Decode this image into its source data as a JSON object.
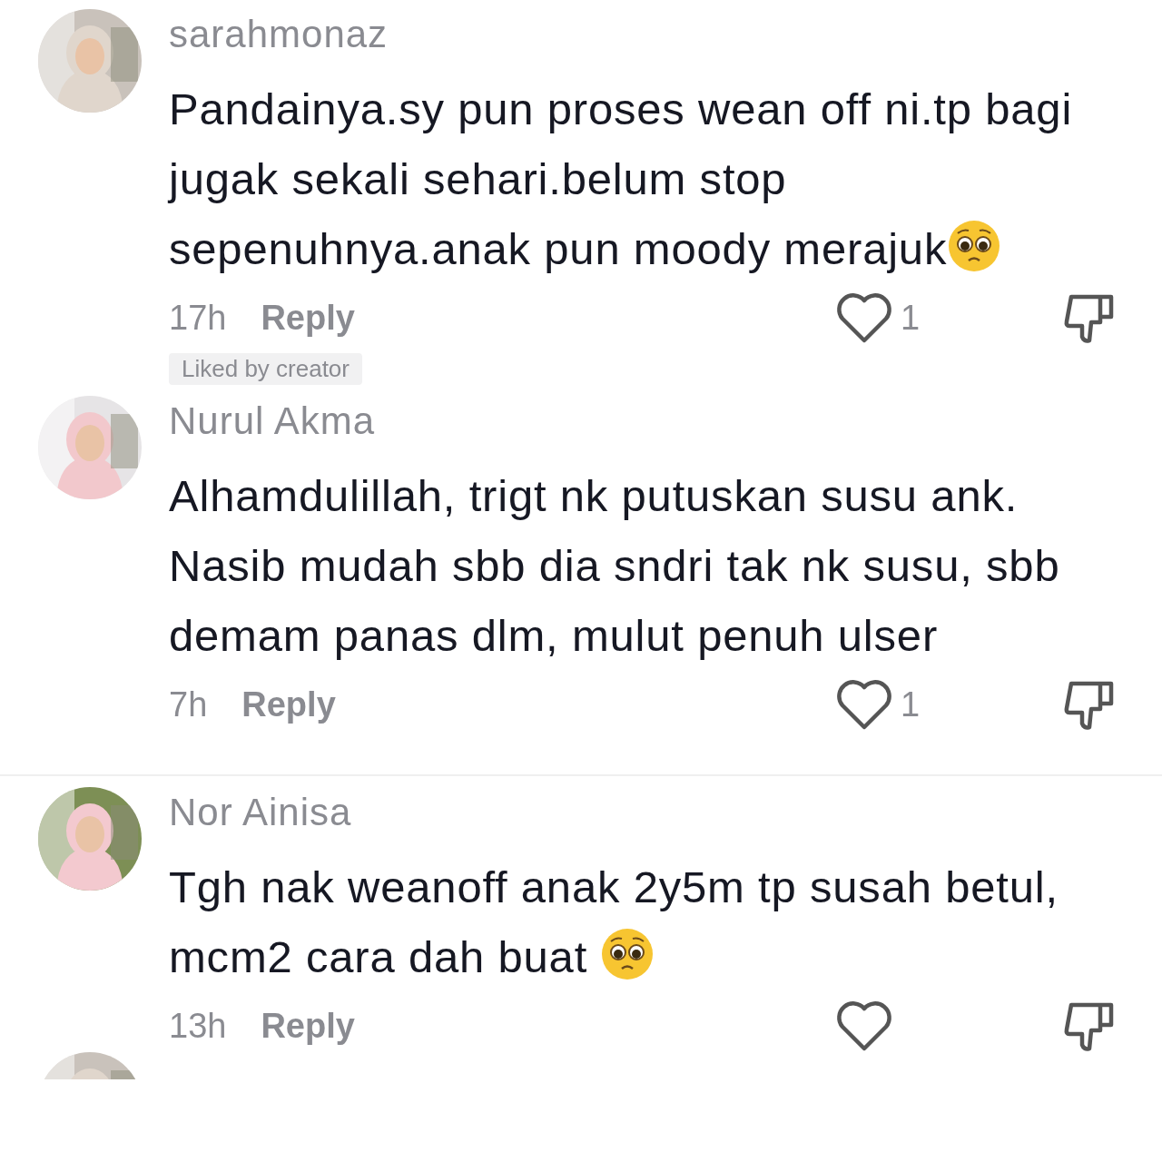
{
  "comments": [
    {
      "kind": "comment",
      "username": "sarahmonaz",
      "avatar": {
        "kind": "picture"
      },
      "lines": [
        "Pandainya.sy pun proses wean off ni.tp bagi",
        "jugak sekali sehari.belum stop",
        "sepenuhnya.anak pun moody merajuk"
      ],
      "trailing_emoji": true,
      "time": "17h",
      "reply": "Reply",
      "likes": "1",
      "liked_by_creator": "Liked by creator",
      "divider_after": false
    },
    {
      "kind": "comment",
      "username": "Nurul Akma",
      "avatar": {
        "kind": "picture"
      },
      "lines": [
        "Alhamdulillah, trigt nk putuskan susu ank.",
        "Nasib mudah sbb dia sndri tak nk susu, sbb",
        "demam panas dlm, mulut penuh ulser"
      ],
      "trailing_emoji": false,
      "time": "7h",
      "reply": "Reply",
      "likes": "1",
      "divider_after": true
    },
    {
      "kind": "comment",
      "username": "Nor Ainisa",
      "avatar": {
        "kind": "picture"
      },
      "lines": [
        "Tgh nak weanoff anak 2y5m tp susah betul,",
        "mcm2 cara dah buat "
      ],
      "trailing_emoji": true,
      "time": "13h",
      "reply": "Reply",
      "divider_after": false
    },
    {
      "kind": "partial",
      "avatar": {
        "kind": "picture"
      }
    }
  ]
}
